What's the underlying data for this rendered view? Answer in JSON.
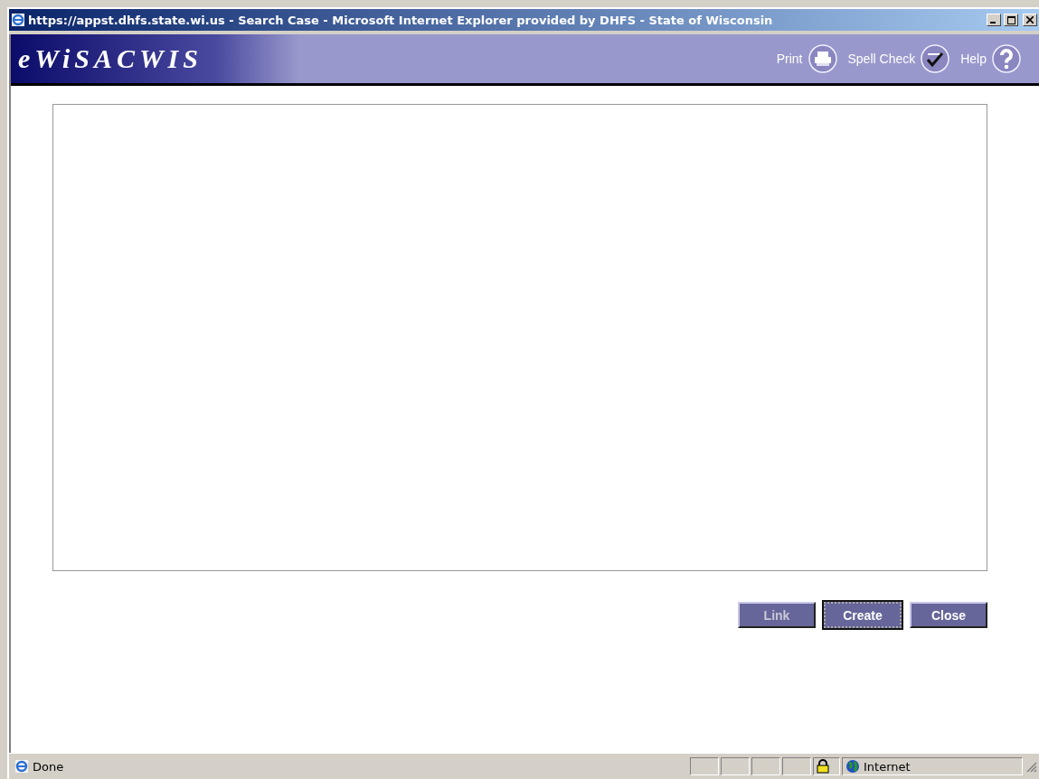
{
  "window": {
    "title": "https://appst.dhfs.state.wi.us - Search Case - Microsoft Internet Explorer provided by DHFS - State of Wisconsin"
  },
  "header": {
    "logo": "eWiSACWIS",
    "tools": [
      {
        "label": "Print",
        "kind": "print"
      },
      {
        "label": "Spell Check",
        "kind": "spell"
      },
      {
        "label": "Help",
        "kind": "help"
      }
    ]
  },
  "buttons": [
    {
      "label": "Link",
      "disabled": true,
      "focused": false
    },
    {
      "label": "Create",
      "disabled": false,
      "focused": true
    },
    {
      "label": "Close",
      "disabled": false,
      "focused": false
    }
  ],
  "status_bar": {
    "text": "Done",
    "zone": "Internet"
  }
}
